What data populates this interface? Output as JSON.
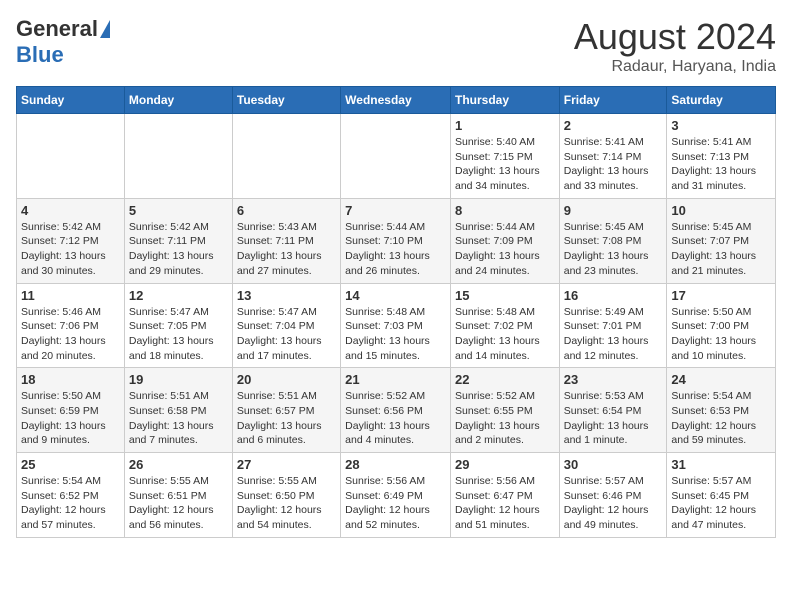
{
  "logo": {
    "general": "General",
    "blue": "Blue"
  },
  "title": "August 2024",
  "subtitle": "Radaur, Haryana, India",
  "days_header": [
    "Sunday",
    "Monday",
    "Tuesday",
    "Wednesday",
    "Thursday",
    "Friday",
    "Saturday"
  ],
  "weeks": [
    [
      {
        "day": "",
        "info": ""
      },
      {
        "day": "",
        "info": ""
      },
      {
        "day": "",
        "info": ""
      },
      {
        "day": "",
        "info": ""
      },
      {
        "day": "1",
        "info": "Sunrise: 5:40 AM\nSunset: 7:15 PM\nDaylight: 13 hours and 34 minutes."
      },
      {
        "day": "2",
        "info": "Sunrise: 5:41 AM\nSunset: 7:14 PM\nDaylight: 13 hours and 33 minutes."
      },
      {
        "day": "3",
        "info": "Sunrise: 5:41 AM\nSunset: 7:13 PM\nDaylight: 13 hours and 31 minutes."
      }
    ],
    [
      {
        "day": "4",
        "info": "Sunrise: 5:42 AM\nSunset: 7:12 PM\nDaylight: 13 hours and 30 minutes."
      },
      {
        "day": "5",
        "info": "Sunrise: 5:42 AM\nSunset: 7:11 PM\nDaylight: 13 hours and 29 minutes."
      },
      {
        "day": "6",
        "info": "Sunrise: 5:43 AM\nSunset: 7:11 PM\nDaylight: 13 hours and 27 minutes."
      },
      {
        "day": "7",
        "info": "Sunrise: 5:44 AM\nSunset: 7:10 PM\nDaylight: 13 hours and 26 minutes."
      },
      {
        "day": "8",
        "info": "Sunrise: 5:44 AM\nSunset: 7:09 PM\nDaylight: 13 hours and 24 minutes."
      },
      {
        "day": "9",
        "info": "Sunrise: 5:45 AM\nSunset: 7:08 PM\nDaylight: 13 hours and 23 minutes."
      },
      {
        "day": "10",
        "info": "Sunrise: 5:45 AM\nSunset: 7:07 PM\nDaylight: 13 hours and 21 minutes."
      }
    ],
    [
      {
        "day": "11",
        "info": "Sunrise: 5:46 AM\nSunset: 7:06 PM\nDaylight: 13 hours and 20 minutes."
      },
      {
        "day": "12",
        "info": "Sunrise: 5:47 AM\nSunset: 7:05 PM\nDaylight: 13 hours and 18 minutes."
      },
      {
        "day": "13",
        "info": "Sunrise: 5:47 AM\nSunset: 7:04 PM\nDaylight: 13 hours and 17 minutes."
      },
      {
        "day": "14",
        "info": "Sunrise: 5:48 AM\nSunset: 7:03 PM\nDaylight: 13 hours and 15 minutes."
      },
      {
        "day": "15",
        "info": "Sunrise: 5:48 AM\nSunset: 7:02 PM\nDaylight: 13 hours and 14 minutes."
      },
      {
        "day": "16",
        "info": "Sunrise: 5:49 AM\nSunset: 7:01 PM\nDaylight: 13 hours and 12 minutes."
      },
      {
        "day": "17",
        "info": "Sunrise: 5:50 AM\nSunset: 7:00 PM\nDaylight: 13 hours and 10 minutes."
      }
    ],
    [
      {
        "day": "18",
        "info": "Sunrise: 5:50 AM\nSunset: 6:59 PM\nDaylight: 13 hours and 9 minutes."
      },
      {
        "day": "19",
        "info": "Sunrise: 5:51 AM\nSunset: 6:58 PM\nDaylight: 13 hours and 7 minutes."
      },
      {
        "day": "20",
        "info": "Sunrise: 5:51 AM\nSunset: 6:57 PM\nDaylight: 13 hours and 6 minutes."
      },
      {
        "day": "21",
        "info": "Sunrise: 5:52 AM\nSunset: 6:56 PM\nDaylight: 13 hours and 4 minutes."
      },
      {
        "day": "22",
        "info": "Sunrise: 5:52 AM\nSunset: 6:55 PM\nDaylight: 13 hours and 2 minutes."
      },
      {
        "day": "23",
        "info": "Sunrise: 5:53 AM\nSunset: 6:54 PM\nDaylight: 13 hours and 1 minute."
      },
      {
        "day": "24",
        "info": "Sunrise: 5:54 AM\nSunset: 6:53 PM\nDaylight: 12 hours and 59 minutes."
      }
    ],
    [
      {
        "day": "25",
        "info": "Sunrise: 5:54 AM\nSunset: 6:52 PM\nDaylight: 12 hours and 57 minutes."
      },
      {
        "day": "26",
        "info": "Sunrise: 5:55 AM\nSunset: 6:51 PM\nDaylight: 12 hours and 56 minutes."
      },
      {
        "day": "27",
        "info": "Sunrise: 5:55 AM\nSunset: 6:50 PM\nDaylight: 12 hours and 54 minutes."
      },
      {
        "day": "28",
        "info": "Sunrise: 5:56 AM\nSunset: 6:49 PM\nDaylight: 12 hours and 52 minutes."
      },
      {
        "day": "29",
        "info": "Sunrise: 5:56 AM\nSunset: 6:47 PM\nDaylight: 12 hours and 51 minutes."
      },
      {
        "day": "30",
        "info": "Sunrise: 5:57 AM\nSunset: 6:46 PM\nDaylight: 12 hours and 49 minutes."
      },
      {
        "day": "31",
        "info": "Sunrise: 5:57 AM\nSunset: 6:45 PM\nDaylight: 12 hours and 47 minutes."
      }
    ]
  ]
}
